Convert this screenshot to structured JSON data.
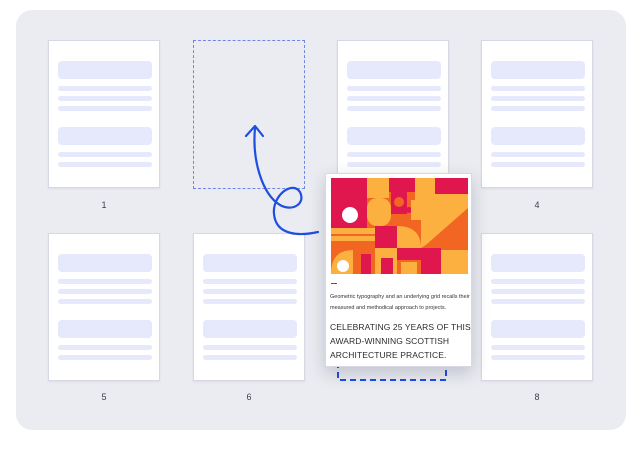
{
  "pages": [
    {
      "number": "1"
    },
    {
      "number": "4"
    },
    {
      "number": "5"
    },
    {
      "number": "6"
    },
    {
      "number": "8"
    }
  ],
  "dragged_page": {
    "caption": "Geometric typography and an underlying grid recalls their measured and methodical approach to projects.",
    "headline": "CELEBRATING 25 YEARS OF THIS AWARD-WINNING SCOTTISH ARCHITECTURE PRACTICE."
  },
  "colors": {
    "board": "#ebecf1",
    "placeholder_block": "#e5e9fb",
    "drop_indicator": "#6f86e6",
    "arrow": "#1f4fe0",
    "art_magenta": "#e0164e",
    "art_orange": "#f26522",
    "art_yellow": "#fbb040"
  },
  "icons": [
    "move-arrow-icon"
  ]
}
